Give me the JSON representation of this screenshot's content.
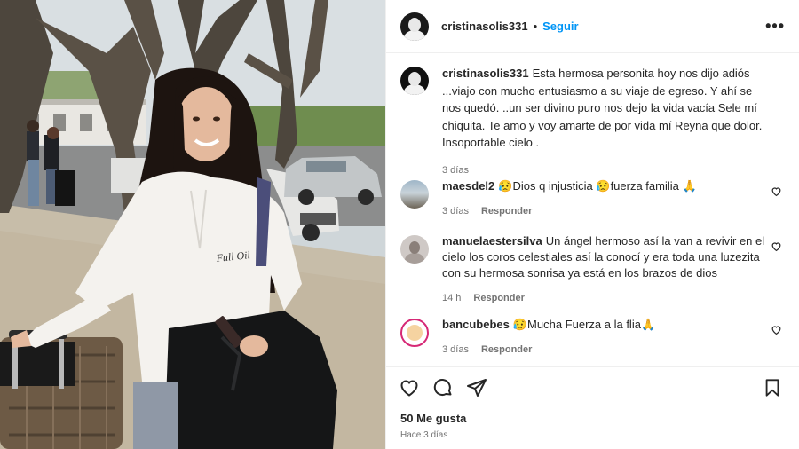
{
  "post": {
    "username": "cristinasolis331",
    "follow_label": "Seguir",
    "separator": "•",
    "more_label": "•••",
    "shirt_text": "Full Oil"
  },
  "caption": {
    "username": "cristinasolis331",
    "text": "Esta hermosa personita hoy nos dijo adiós ...viajo con mucho entusiasmo a su viaje de egreso. Y ahí se nos quedó. ..un ser divino puro nos dejo la vida vacía Sele mí chiquita. Te amo y voy amarte de por vida mí Reyna que dolor. Insoportable cielo .",
    "time": "3 días"
  },
  "comments": [
    {
      "username": "maesdel2",
      "text": "😥Dios q injusticia 😥fuerza familia 🙏",
      "time": "3 días",
      "reply": "Responder"
    },
    {
      "username": "manuelaestersilva",
      "text": "Un ángel hermoso así la van a revivir en el cielo los coros celestiales así la conocí y era toda una luzezita con su hermosa sonrisa ya está en los brazos de dios",
      "time": "14 h",
      "reply": "Responder"
    },
    {
      "username": "bancubebes",
      "text": "😥Mucha Fuerza a la flia🙏",
      "time": "3 días",
      "reply": "Responder"
    }
  ],
  "footer": {
    "likes": "50 Me gusta",
    "ago": "Hace 3 días"
  },
  "icons": [
    "heart-icon",
    "comment-icon",
    "share-icon",
    "bookmark-icon",
    "more-icon"
  ],
  "colors": {
    "link": "#0095f6",
    "muted": "#737373",
    "text": "#262626"
  }
}
